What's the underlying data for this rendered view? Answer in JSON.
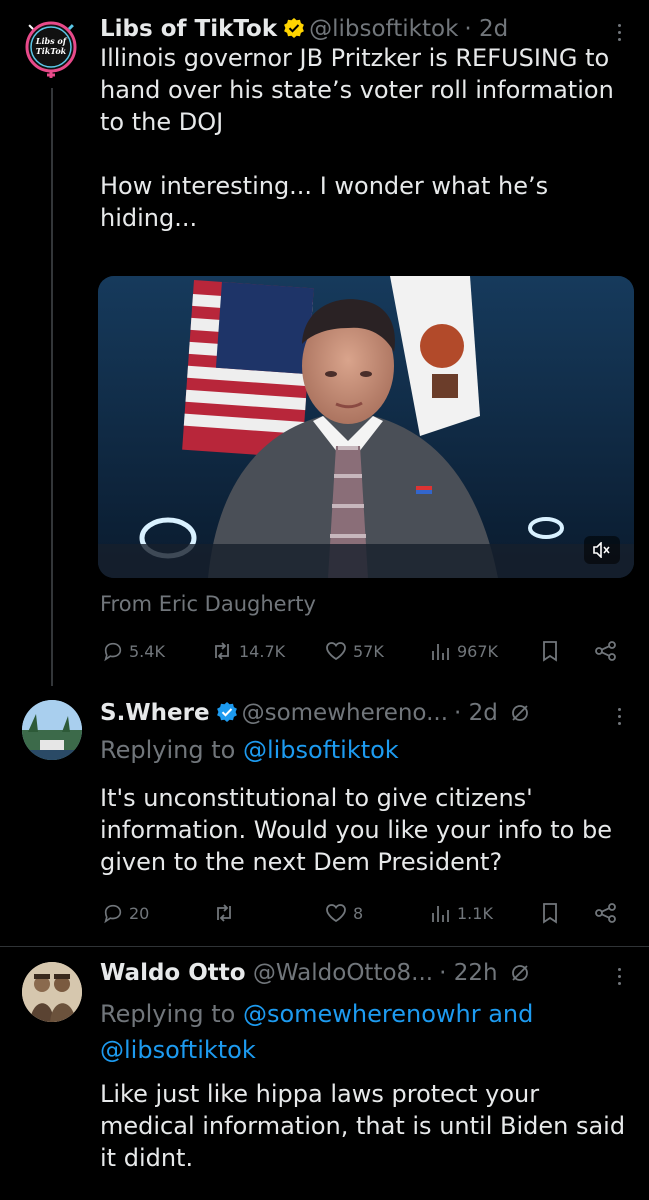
{
  "colors": {
    "background": "#000000",
    "text": "#e7e9ea",
    "muted": "#71767b",
    "link": "#1d9bf0",
    "verified": "#ffd400",
    "verified_blue": "#1d9bf0"
  },
  "tweets": [
    {
      "author": "Libs of TikTok",
      "handle": "@libsoftiktok",
      "time": "· 2d",
      "avatar_text": "Libs of TikTok",
      "verified_badge": "gold-verified-icon",
      "text": "Illinois governor JB Pritzker is REFUSING to hand over his state’s voter roll information to the DOJ\n\nHow interesting... I wonder what he’s hiding...",
      "media_source": "From Eric Daugherty",
      "stats": {
        "replies": "5.4K",
        "reposts": "14.7K",
        "likes": "57K",
        "views": "967K"
      }
    },
    {
      "author": "S.Where",
      "handle": "@somewhereno...",
      "time": "· 2d",
      "verified_badge": "blue-verified-icon",
      "replying_prefix": "Replying to",
      "replying_to": "@libsoftiktok",
      "text": "It's unconstitutional to give citizens' information. Would you like your info to be given to the next Dem President?",
      "stats": {
        "replies": "20",
        "reposts": "",
        "likes": "8",
        "views": "1.1K"
      }
    },
    {
      "author": "Waldo Otto",
      "handle": "@WaldoOtto8...",
      "time": "· 22h",
      "replying_prefix": "Replying to",
      "replying_to": "@somewherenowhr and",
      "replying_to_2": "@libsoftiktok",
      "text": "Like just like hippa laws protect your medical information, that is until Biden said it didnt."
    }
  ]
}
